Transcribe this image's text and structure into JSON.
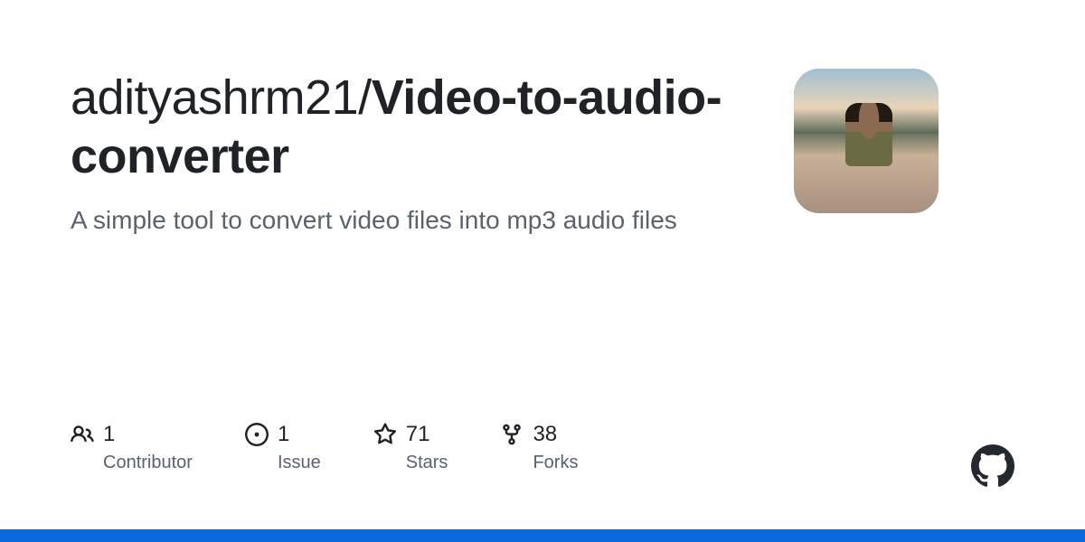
{
  "repo": {
    "owner": "adityashrm21",
    "separator": "/",
    "name": "Video-to-audio-converter",
    "description": "A simple tool to convert video files into mp3 audio files"
  },
  "stats": [
    {
      "icon": "people-icon",
      "value": "1",
      "label": "Contributor"
    },
    {
      "icon": "issue-icon",
      "value": "1",
      "label": "Issue"
    },
    {
      "icon": "star-icon",
      "value": "71",
      "label": "Stars"
    },
    {
      "icon": "fork-icon",
      "value": "38",
      "label": "Forks"
    }
  ],
  "colors": {
    "accent": "#0969da"
  }
}
